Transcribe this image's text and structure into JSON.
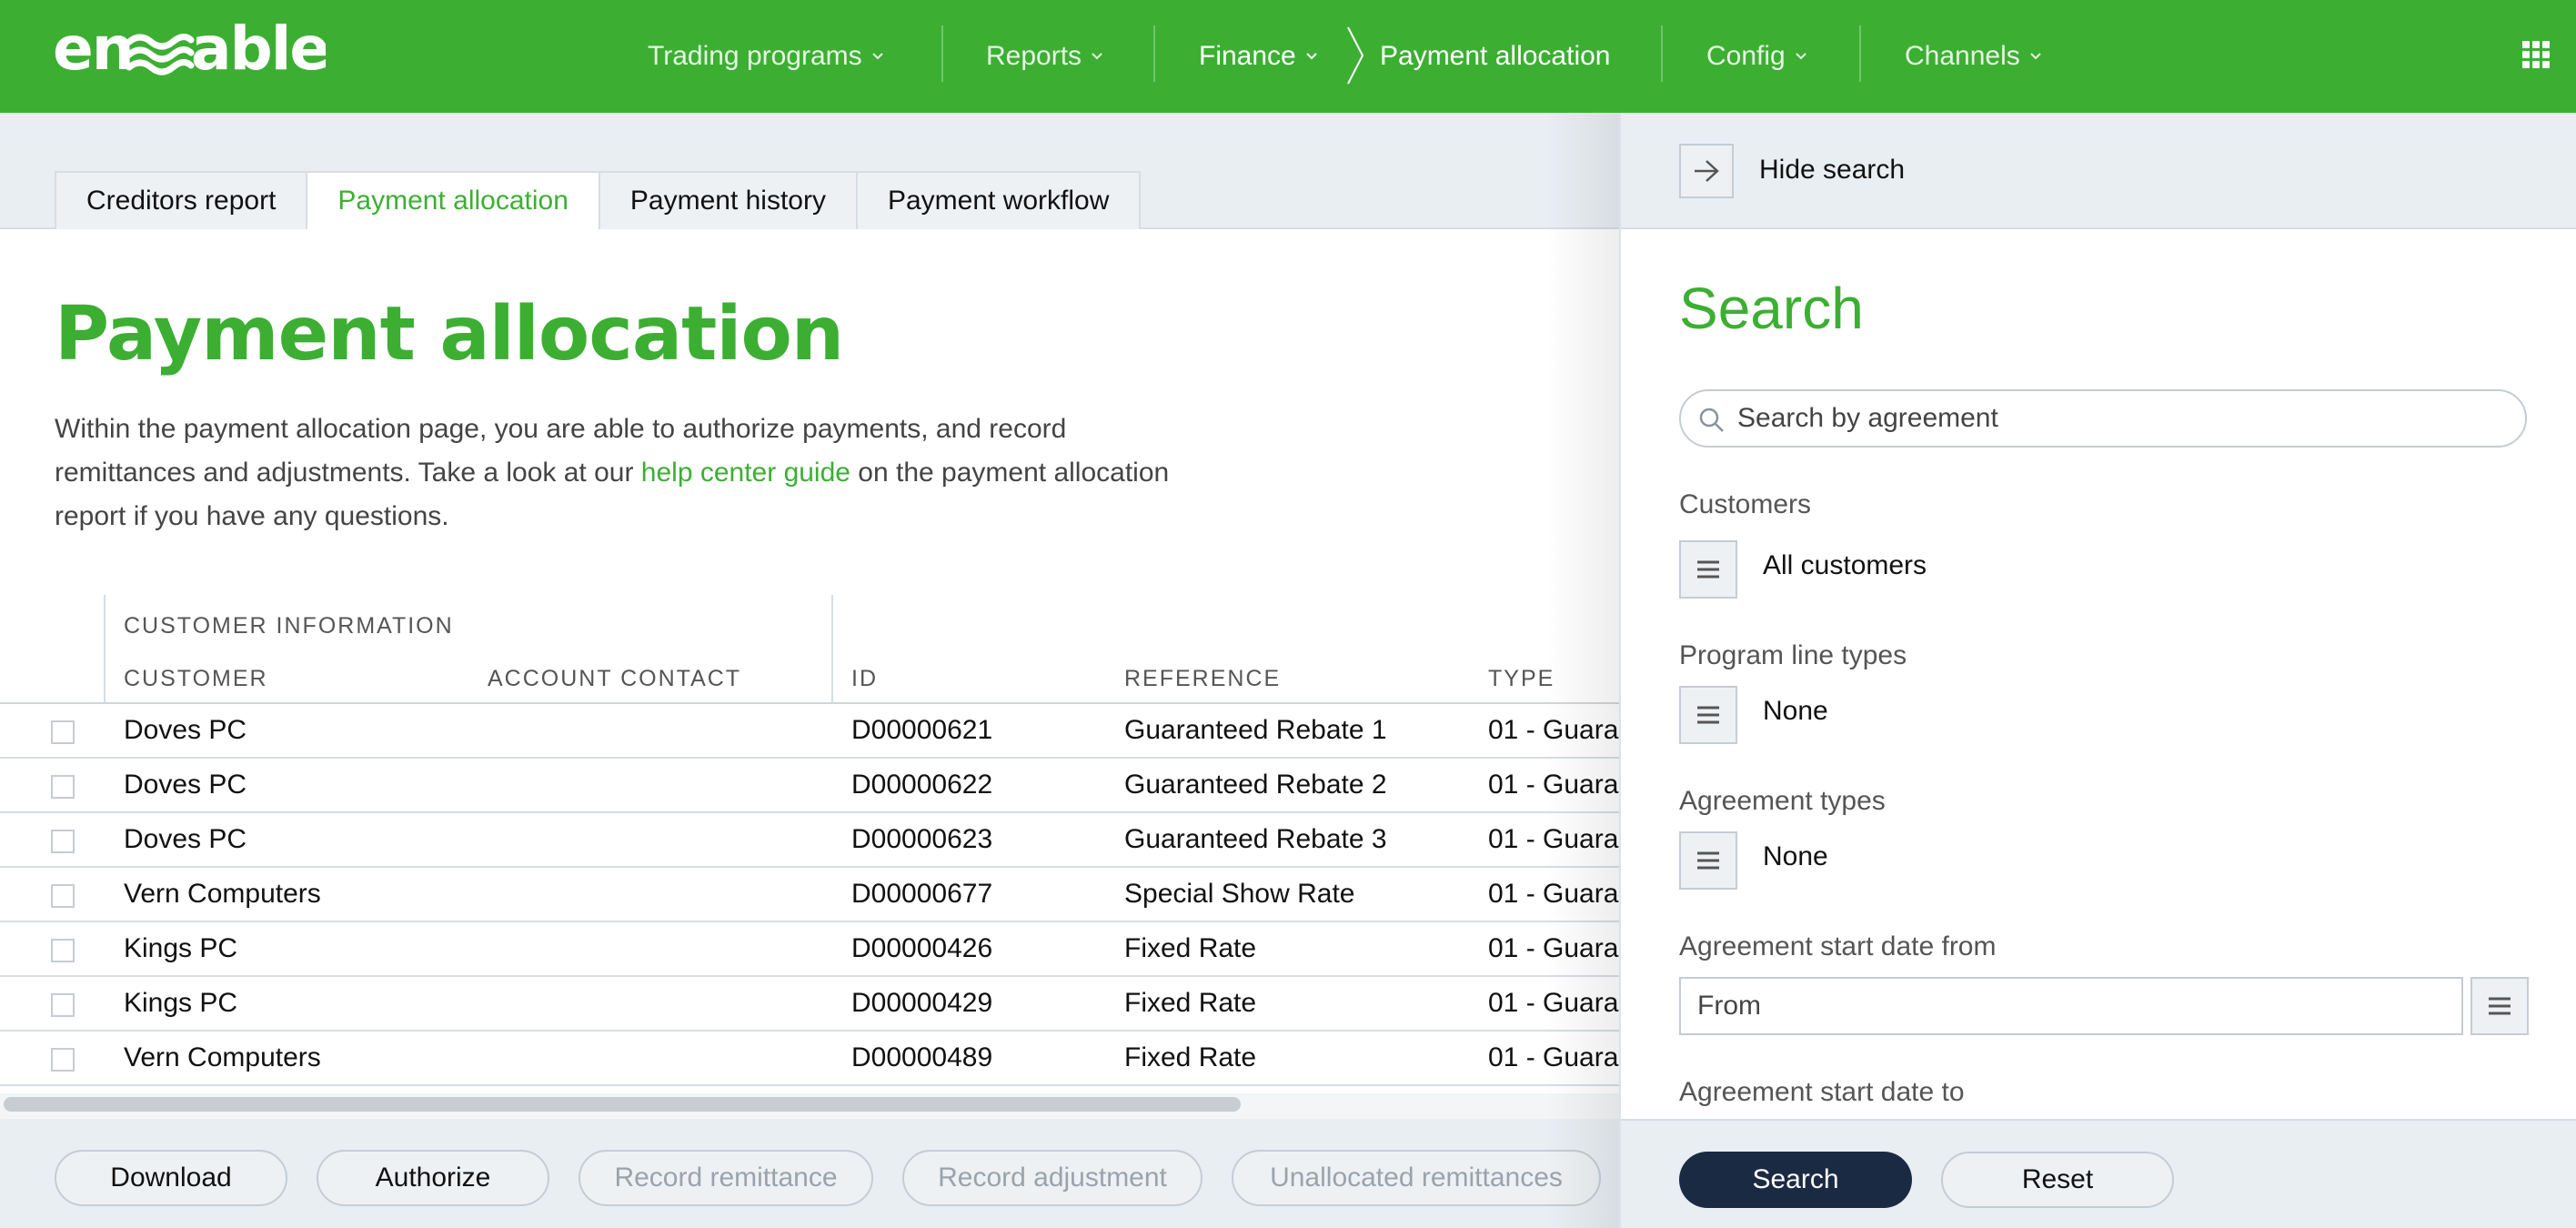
{
  "brand": {
    "logo_text": "enable",
    "primary_color": "#3caf33",
    "dark_button_color": "#1b2a43"
  },
  "nav": {
    "items": [
      {
        "label": "Trading programs"
      },
      {
        "label": "Reports"
      },
      {
        "label": "Finance"
      },
      {
        "label": "Config"
      },
      {
        "label": "Channels"
      }
    ],
    "current_page": "Payment allocation"
  },
  "tabs": [
    {
      "label": "Creditors report"
    },
    {
      "label": "Payment allocation",
      "active": true
    },
    {
      "label": "Payment history"
    },
    {
      "label": "Payment workflow"
    }
  ],
  "page": {
    "title": "Payment allocation",
    "description_before": "Within the payment allocation page, you are able to authorize payments, and record remittances and adjustments. Take a look at our ",
    "description_link": "help center guide",
    "description_after": " on the payment allocation report if you have any questions."
  },
  "table": {
    "group_header": "CUSTOMER INFORMATION",
    "columns": [
      "CUSTOMER",
      "ACCOUNT CONTACT",
      "ID",
      "REFERENCE",
      "TYPE"
    ],
    "rows": [
      {
        "customer": "Doves PC",
        "account_contact": "",
        "id": "D00000621",
        "reference": "Guaranteed Rebate 1",
        "type": "01 - Guara"
      },
      {
        "customer": "Doves PC",
        "account_contact": "",
        "id": "D00000622",
        "reference": "Guaranteed Rebate 2",
        "type": "01 - Guara"
      },
      {
        "customer": "Doves PC",
        "account_contact": "",
        "id": "D00000623",
        "reference": "Guaranteed Rebate 3",
        "type": "01 - Guara"
      },
      {
        "customer": "Vern Computers",
        "account_contact": "",
        "id": "D00000677",
        "reference": "Special Show Rate",
        "type": "01 - Guara"
      },
      {
        "customer": "Kings PC",
        "account_contact": "",
        "id": "D00000426",
        "reference": "Fixed Rate",
        "type": "01 - Guara"
      },
      {
        "customer": "Kings PC",
        "account_contact": "",
        "id": "D00000429",
        "reference": "Fixed Rate",
        "type": "01 - Guara"
      },
      {
        "customer": "Vern Computers",
        "account_contact": "",
        "id": "D00000489",
        "reference": "Fixed Rate",
        "type": "01 - Guara"
      }
    ]
  },
  "toolbar": {
    "download": "Download",
    "authorize": "Authorize",
    "record_remittance": "Record remittance",
    "record_adjustment": "Record adjustment",
    "unallocated_remittances": "Unallocated remittances"
  },
  "search_panel": {
    "hide_label": "Hide search",
    "title": "Search",
    "search_placeholder": "Search by agreement",
    "customers_label": "Customers",
    "customers_value": "All customers",
    "program_line_types_label": "Program line types",
    "program_line_types_value": "None",
    "agreement_types_label": "Agreement types",
    "agreement_types_value": "None",
    "start_date_from_label": "Agreement start date from",
    "start_date_from_placeholder": "From",
    "start_date_to_label": "Agreement start date to",
    "search_button": "Search",
    "reset_button": "Reset"
  },
  "icons": {
    "chevron": "chevron-down-icon",
    "breadcrumb": "chevron-right-icon",
    "apps": "apps-grid-icon",
    "hide": "arrow-right-icon",
    "search": "search-icon",
    "list": "list-icon"
  }
}
